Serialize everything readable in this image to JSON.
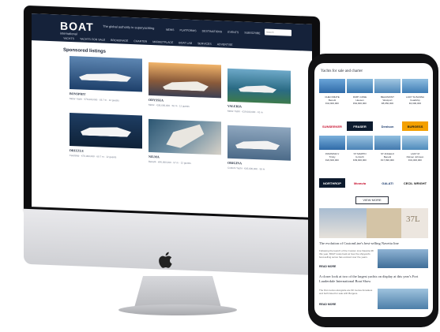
{
  "imac": {
    "logo": "BOAT",
    "logo_sub": "international",
    "tagline": "The global authority in superyachting",
    "top_nav": [
      "NEWS",
      "PLATFORMS",
      "DESTINATIONS",
      "EVENTS",
      "SUBSCRIBE",
      "NEWSLETTERS"
    ],
    "nav": [
      "YACHTS",
      "YACHTS FOR SALE",
      "BROKERAGE",
      "CHARTER",
      "MARKETPLACE",
      "BOAT LAB",
      "SERVICES",
      "ADVERTISE"
    ],
    "search_placeholder": "Search",
    "section_title": "Sponsored listings",
    "listings": [
      {
        "name": "BONSPRIT",
        "meta": "Motor Yacht · €78,000,000 · 63.7 m · 12 guests"
      },
      {
        "name": "ODYSSEA",
        "meta": "Motor · €30,000,000 · 50 m · 11 guests"
      },
      {
        "name": "VALERIA",
        "meta": "Motor Yacht · €19,000,000 · 41 m"
      },
      {
        "name": "DRIZZLE",
        "meta": "Feadship · €78,000,000 · 60.7 m · 12 guests"
      },
      {
        "name": "NILMA",
        "meta": "Benetti · €45,000,000 · 57 m · 12 guests"
      },
      {
        "name": "ORIGINA",
        "meta": "Custom Yacht · €45,000,000 · 55 m"
      }
    ]
  },
  "phone": {
    "title": "Yachts for sale and charter",
    "row1": [
      {
        "name": "CHECKMATE",
        "maker": "Benetti",
        "price": "€44,900,000"
      },
      {
        "name": "RUBY ANNE",
        "maker": "Heesen",
        "price": "€64,900,000"
      },
      {
        "name": "BEAUMONT",
        "maker": "Westport",
        "price": "€8,950,000"
      },
      {
        "name": "LADY SUSANNA",
        "maker": "Feadship",
        "price": "€4,900,000"
      }
    ],
    "logos1": [
      "SUNSEEKER",
      "FRASER",
      "Denison",
      "BURGESS"
    ],
    "row2": [
      {
        "name": "INSOMNIA V",
        "maker": "Trinity",
        "price": "€22,600,000"
      },
      {
        "name": "ST MARTIN",
        "maker": "G-North",
        "price": "€39,900,000"
      },
      {
        "name": "ST ANGELO",
        "maker": "Benetti",
        "price": "€17,990,000"
      },
      {
        "name": "LADY M",
        "maker": "Palmer Johnson",
        "price": "€31,000,000"
      }
    ],
    "logos2": [
      "NORTHROP",
      "Moravia",
      "GALATI",
      "CECIL WRIGHT"
    ],
    "view_more": "VIEW MORE",
    "ad_text": "37L",
    "article1_title": "The evolution of CustomLine's best-selling Navetta line",
    "article1_body": "Following the launch of the Custom Line Navetta 38 this year, BOAT looks back at how the shipyard's best-selling series has evolved over the years.",
    "read_more": "READ MORE",
    "article2_title": "A closer look at two of the largest yachts on display at this year's Fort Lauderdale International Boat Show",
    "article2_body": "The first metres alongside are 90 metres Amadeus and both listed for sale with Burgess."
  },
  "colors": {
    "header": "#15223a",
    "accent": "#d4c4a6"
  }
}
